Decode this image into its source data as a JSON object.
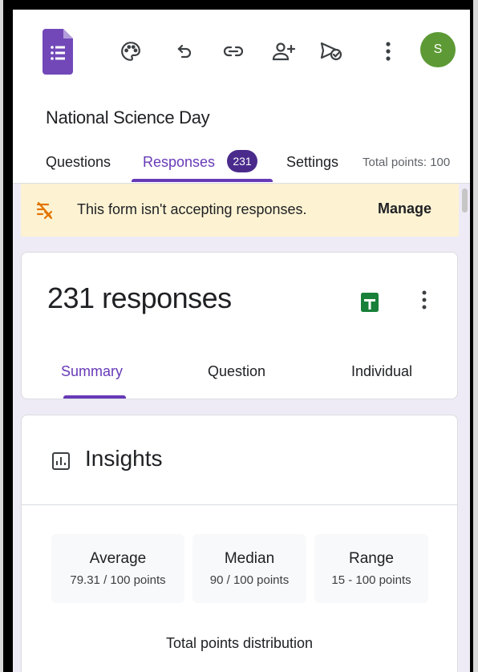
{
  "form": {
    "title": "National Science Day"
  },
  "toolbar": {
    "avatar_initial": "S"
  },
  "tabs": {
    "questions": "Questions",
    "responses": "Responses",
    "responses_count": "231",
    "settings": "Settings",
    "total_points": "Total points: 100"
  },
  "banner": {
    "text": "This form isn't accepting responses.",
    "manage": "Manage"
  },
  "responses_card": {
    "title": "231 responses",
    "subtabs": [
      "Summary",
      "Question",
      "Individual"
    ]
  },
  "insights": {
    "title": "Insights",
    "stats": [
      {
        "label": "Average",
        "value": "79.31 / 100 points"
      },
      {
        "label": "Median",
        "value": "90 / 100 points"
      },
      {
        "label": "Range",
        "value": "15 - 100 points"
      }
    ],
    "distribution_title": "Total points distribution"
  },
  "colors": {
    "accent": "#673ab7",
    "badge": "#4a2b8c",
    "avatar": "#5d9a35",
    "banner_bg": "#fdf3d3",
    "content_bg": "#efebf6",
    "sheets_green": "#188038"
  }
}
